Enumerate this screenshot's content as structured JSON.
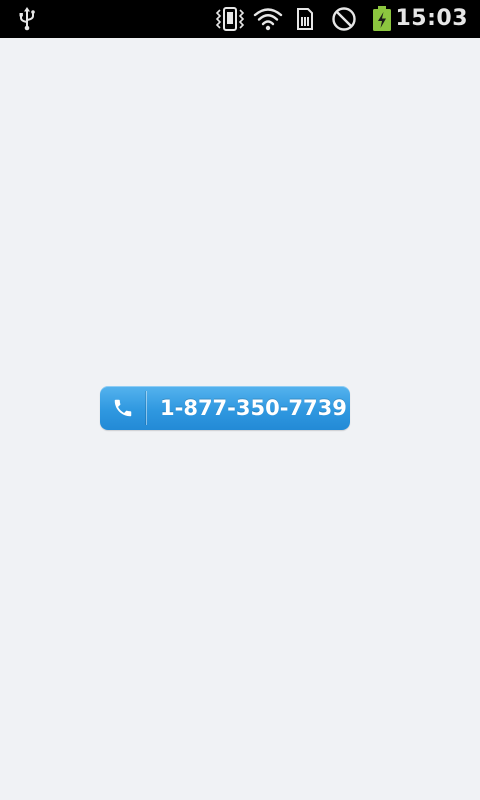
{
  "status_bar": {
    "time": "15:03",
    "icons": [
      "usb-icon",
      "vibrate-icon",
      "wifi-icon",
      "sim-card-icon",
      "no-signal-icon",
      "battery-charging-icon"
    ],
    "battery_color": "#8cc63f"
  },
  "call_button": {
    "phone_number": "1-877-350-7739",
    "icon": "phone-icon",
    "accent_color": "#2f98e0"
  },
  "colors": {
    "background": "#f0f2f5",
    "status_bar_background": "#000000"
  }
}
